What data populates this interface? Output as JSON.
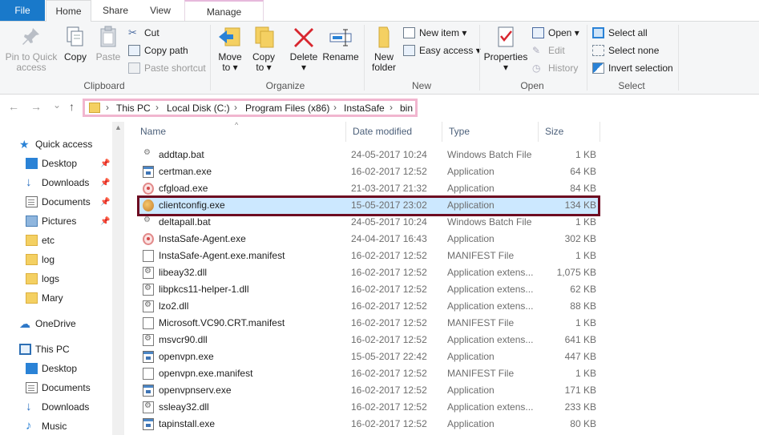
{
  "tabs": {
    "file": "File",
    "home": "Home",
    "share": "Share",
    "view": "View",
    "manage": "Manage"
  },
  "ribbon": {
    "clipboard": {
      "label": "Clipboard",
      "pin": "Pin to Quick access",
      "pin_line1": "Pin to Quick",
      "pin_line2": "access",
      "copy": "Copy",
      "paste": "Paste",
      "cut": "Cut",
      "copy_path": "Copy path",
      "paste_shortcut": "Paste shortcut"
    },
    "organize": {
      "label": "Organize",
      "move_to": "Move",
      "move_to2": "to ▾",
      "copy_to": "Copy",
      "copy_to2": "to ▾",
      "delete": "Delete",
      "delete2": "▾",
      "rename": "Rename"
    },
    "new": {
      "label": "New",
      "new_folder": "New",
      "new_folder2": "folder",
      "new_item": "New item ▾",
      "easy_access": "Easy access ▾"
    },
    "open": {
      "label": "Open",
      "properties": "Properties",
      "properties2": "▾",
      "open": "Open ▾",
      "edit": "Edit",
      "history": "History"
    },
    "select": {
      "label": "Select",
      "select_all": "Select all",
      "select_none": "Select none",
      "invert": "Invert selection"
    }
  },
  "nav": {
    "back": "←",
    "forward": "→",
    "recent": "⌄",
    "up": "↑",
    "crumbs": [
      "This PC",
      "Local Disk (C:)",
      "Program Files (x86)",
      "InstaSafe",
      "bin"
    ]
  },
  "sidebar": {
    "items": [
      {
        "label": "Quick access",
        "icon": "star-icon"
      },
      {
        "label": "Desktop",
        "icon": "desktop-icon",
        "pinned": true
      },
      {
        "label": "Downloads",
        "icon": "download-icon",
        "pinned": true
      },
      {
        "label": "Documents",
        "icon": "documents-icon",
        "pinned": true
      },
      {
        "label": "Pictures",
        "icon": "pictures-icon",
        "pinned": true
      },
      {
        "label": "etc",
        "icon": "folder-icon"
      },
      {
        "label": "log",
        "icon": "folder-icon"
      },
      {
        "label": "logs",
        "icon": "folder-icon"
      },
      {
        "label": "Mary",
        "icon": "folder-icon"
      },
      {
        "label": "OneDrive",
        "icon": "cloud-icon"
      },
      {
        "label": "This PC",
        "icon": "computer-icon"
      },
      {
        "label": "Desktop",
        "icon": "desktop-icon"
      },
      {
        "label": "Documents",
        "icon": "documents-icon"
      },
      {
        "label": "Downloads",
        "icon": "download-icon"
      },
      {
        "label": "Music",
        "icon": "music-icon"
      }
    ]
  },
  "columns": {
    "name": "Name",
    "date": "Date modified",
    "type": "Type",
    "size": "Size"
  },
  "files": [
    {
      "name": "addtap.bat",
      "date": "24-05-2017 10:24",
      "type": "Windows Batch File",
      "size": "1 KB",
      "icon": "bat"
    },
    {
      "name": "certman.exe",
      "date": "16-02-2017 12:52",
      "type": "Application",
      "size": "64 KB",
      "icon": "app"
    },
    {
      "name": "cfgload.exe",
      "date": "21-03-2017 21:32",
      "type": "Application",
      "size": "84 KB",
      "icon": "red"
    },
    {
      "name": "clientconfig.exe",
      "date": "15-05-2017 23:02",
      "type": "Application",
      "size": "134 KB",
      "icon": "client",
      "selected": true
    },
    {
      "name": "deltapall.bat",
      "date": "24-05-2017 10:24",
      "type": "Windows Batch File",
      "size": "1 KB",
      "icon": "bat"
    },
    {
      "name": "InstaSafe-Agent.exe",
      "date": "24-04-2017 16:43",
      "type": "Application",
      "size": "302 KB",
      "icon": "red"
    },
    {
      "name": "InstaSafe-Agent.exe.manifest",
      "date": "16-02-2017 12:52",
      "type": "MANIFEST File",
      "size": "1 KB",
      "icon": "doc"
    },
    {
      "name": "libeay32.dll",
      "date": "16-02-2017 12:52",
      "type": "Application extens...",
      "size": "1,075 KB",
      "icon": "dll"
    },
    {
      "name": "libpkcs11-helper-1.dll",
      "date": "16-02-2017 12:52",
      "type": "Application extens...",
      "size": "62 KB",
      "icon": "dll"
    },
    {
      "name": "lzo2.dll",
      "date": "16-02-2017 12:52",
      "type": "Application extens...",
      "size": "88 KB",
      "icon": "dll"
    },
    {
      "name": "Microsoft.VC90.CRT.manifest",
      "date": "16-02-2017 12:52",
      "type": "MANIFEST File",
      "size": "1 KB",
      "icon": "doc"
    },
    {
      "name": "msvcr90.dll",
      "date": "16-02-2017 12:52",
      "type": "Application extens...",
      "size": "641 KB",
      "icon": "dll"
    },
    {
      "name": "openvpn.exe",
      "date": "15-05-2017 22:42",
      "type": "Application",
      "size": "447 KB",
      "icon": "app"
    },
    {
      "name": "openvpn.exe.manifest",
      "date": "16-02-2017 12:52",
      "type": "MANIFEST File",
      "size": "1 KB",
      "icon": "doc"
    },
    {
      "name": "openvpnserv.exe",
      "date": "16-02-2017 12:52",
      "type": "Application",
      "size": "171 KB",
      "icon": "app"
    },
    {
      "name": "ssleay32.dll",
      "date": "16-02-2017 12:52",
      "type": "Application extens...",
      "size": "233 KB",
      "icon": "dll"
    },
    {
      "name": "tapinstall.exe",
      "date": "16-02-2017 12:52",
      "type": "Application",
      "size": "80 KB",
      "icon": "app"
    }
  ],
  "colors": {
    "file_tab": "#1979ca",
    "selection": "#cce8ff",
    "address_highlight": "#f1b6cf",
    "selection_box": "#6d0b21"
  }
}
